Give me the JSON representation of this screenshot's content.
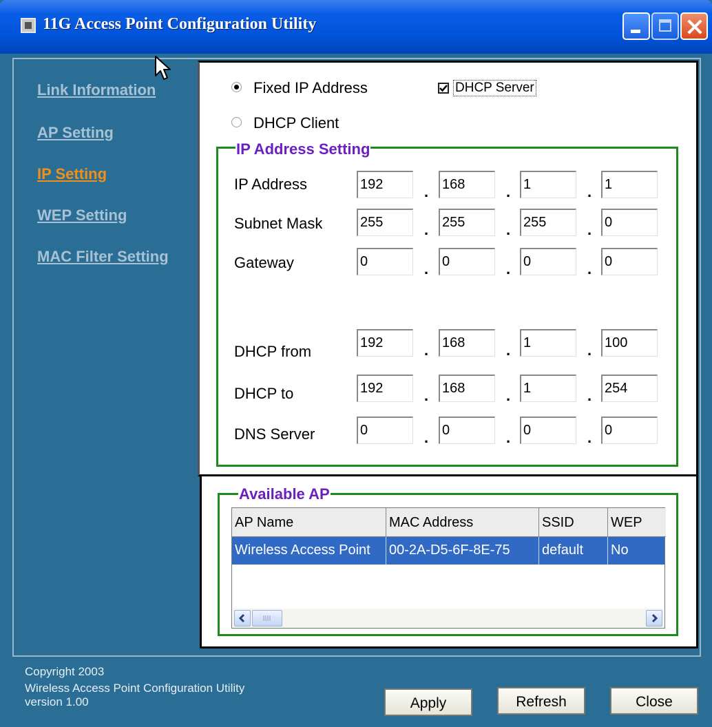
{
  "window": {
    "title": "11G Access Point Configuration Utility"
  },
  "sidebar": {
    "items": [
      {
        "label": "Link Information"
      },
      {
        "label": "AP Setting"
      },
      {
        "label": "IP Setting",
        "active": true
      },
      {
        "label": "WEP Setting"
      },
      {
        "label": "MAC Filter Setting"
      }
    ]
  },
  "ip_mode": {
    "fixed_label": "Fixed IP Address",
    "dhcp_client_label": "DHCP Client",
    "selected": "Fixed IP Address",
    "dhcp_server_label": "DHCP Server",
    "dhcp_server_checked": true
  },
  "ip_group": {
    "legend": "IP Address Setting",
    "rows": [
      {
        "label": "IP Address",
        "octets": [
          "192",
          "168",
          "1",
          "1"
        ]
      },
      {
        "label": "Subnet Mask",
        "octets": [
          "255",
          "255",
          "255",
          "0"
        ]
      },
      {
        "label": "Gateway",
        "octets": [
          "0",
          "0",
          "0",
          "0"
        ]
      },
      {
        "label": "DHCP from",
        "octets": [
          "192",
          "168",
          "1",
          "100"
        ]
      },
      {
        "label": "DHCP to",
        "octets": [
          "192",
          "168",
          "1",
          "254"
        ]
      },
      {
        "label": "DNS Server",
        "octets": [
          "0",
          "0",
          "0",
          "0"
        ]
      }
    ]
  },
  "ap_group": {
    "legend": "Available AP",
    "columns": [
      "AP Name",
      "MAC Address",
      "SSID",
      "WEP"
    ],
    "rows": [
      [
        "Wireless Access Point",
        "00-2A-D5-6F-8E-75",
        "default",
        "No"
      ]
    ]
  },
  "footer": {
    "copyright": "Copyright 2003",
    "product": "Wireless Access Point Configuration Utility",
    "version": "version 1.00",
    "apply_label": "Apply",
    "refresh_label": "Refresh",
    "close_label": "Close"
  },
  "colors": {
    "background": "#2b6e95",
    "active_nav": "#f09018",
    "nav": "#a7c2d4",
    "group_border": "#1e8a1e",
    "legend": "#6b1fbf",
    "selection": "#316ac5"
  }
}
